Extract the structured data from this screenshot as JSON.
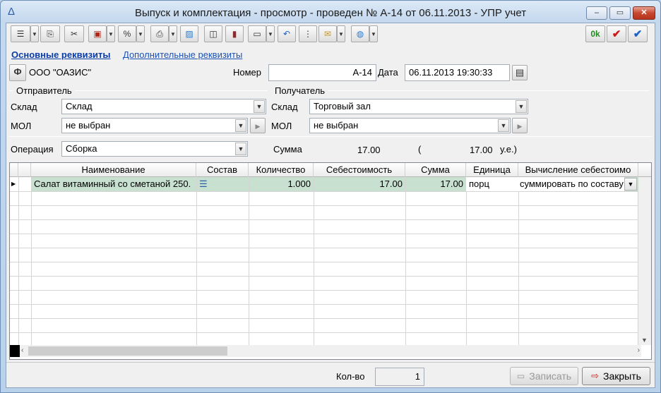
{
  "window": {
    "title": "Выпуск и комплектация - просмотр - проведен № А-14 от 06.11.2013 - УПР учет",
    "minimize": "–",
    "maximize": "▭",
    "close": "✕"
  },
  "toolbar": {
    "ok_label": "0k",
    "icons": [
      "list-icon",
      "copy-icon",
      "scissors-icon",
      "document-arrow-icon",
      "percent-icon",
      "printer-icon",
      "image-icon",
      "book-icon",
      "journal-icon",
      "tag-icon",
      "undo-icon",
      "tree-icon",
      "envelope-icon",
      "globe-icon",
      "check-red-icon",
      "check-blue-icon"
    ]
  },
  "tabs": {
    "main": "Основные реквизиты",
    "additional": "Дополнительные реквизиты"
  },
  "header": {
    "org_button": "Ф",
    "org_name": "ООО \"ОАЗИС\"",
    "number_label": "Номер",
    "number_value": "А-14",
    "date_label": "Дата",
    "date_value": "06.11.2013 19:30:33"
  },
  "sender": {
    "title": "Отправитель",
    "warehouse_label": "Склад",
    "warehouse_value": "Склад",
    "mol_label": "МОЛ",
    "mol_value": "не выбран"
  },
  "receiver": {
    "title": "Получатель",
    "warehouse_label": "Склад",
    "warehouse_value": "Торговый зал",
    "mol_label": "МОЛ",
    "mol_value": "не выбран"
  },
  "operation": {
    "label": "Операция",
    "value": "Сборка",
    "sum_label": "Сумма",
    "sum_value": "17.00",
    "paren_open": "(",
    "sum_ue_value": "17.00",
    "ue_label": "у.е.)"
  },
  "table": {
    "columns": [
      "Наименование",
      "Состав",
      "Количество",
      "Себестоимость",
      "Сумма",
      "Единица",
      "Вычисление себестоимо"
    ],
    "rows": [
      {
        "name": "Салат витаминный со сметаной 250.",
        "qty": "1.000",
        "cost": "17.00",
        "sum": "17.00",
        "unit": "порц",
        "calc": "суммировать по составу"
      }
    ]
  },
  "footer": {
    "count_label": "Кол-во",
    "count_value": "1",
    "save_label": "Записать",
    "close_label": "Закрыть"
  }
}
